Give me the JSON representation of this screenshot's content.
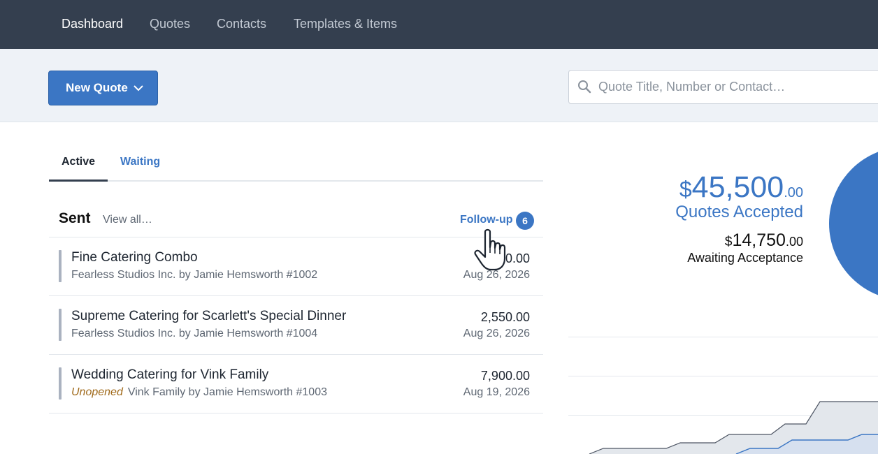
{
  "nav": {
    "items": [
      {
        "label": "Dashboard",
        "active": true
      },
      {
        "label": "Quotes",
        "active": false
      },
      {
        "label": "Contacts",
        "active": false
      },
      {
        "label": "Templates & Items",
        "active": false
      }
    ]
  },
  "toolbar": {
    "new_quote_label": "New Quote",
    "search_placeholder": "Quote Title, Number or Contact…",
    "search_value": ""
  },
  "tabs": [
    {
      "label": "Active",
      "selected": true
    },
    {
      "label": "Waiting",
      "selected": false
    }
  ],
  "sent": {
    "title": "Sent",
    "view_all": "View all…",
    "follow_up_label": "Follow-up",
    "follow_up_count": "6"
  },
  "quotes": [
    {
      "title": "Fine Catering Combo",
      "status": "",
      "subtitle": "Fearless Studios Inc. by Jamie Hemsworth #1002",
      "amount": "0.00",
      "date": "Aug 26, 2026"
    },
    {
      "title": "Supreme Catering for Scarlett's Special Dinner",
      "status": "",
      "subtitle": "Fearless Studios Inc. by Jamie Hemsworth #1004",
      "amount": "2,550.00",
      "date": "Aug 26, 2026"
    },
    {
      "title": "Wedding Catering for Vink Family",
      "status": "Unopened",
      "subtitle": "Vink Family by Jamie Hemsworth #1003",
      "amount": "7,900.00",
      "date": "Aug 19, 2026"
    }
  ],
  "stats": {
    "accepted": {
      "currency": "$",
      "whole": "45,500",
      "cents": ".00",
      "label": "Quotes Accepted"
    },
    "awaiting": {
      "currency": "$",
      "whole": "14,750",
      "cents": ".00",
      "label": "Awaiting Acceptance"
    }
  },
  "colors": {
    "nav_bg": "#343f4f",
    "accent": "#3b76c4",
    "unopened": "#a06a1b",
    "toolbar_bg": "#eef2f7"
  },
  "icons": {
    "search": "search-icon",
    "dropdown": "chevron-down-icon",
    "cursor": "hand-pointer-icon"
  }
}
